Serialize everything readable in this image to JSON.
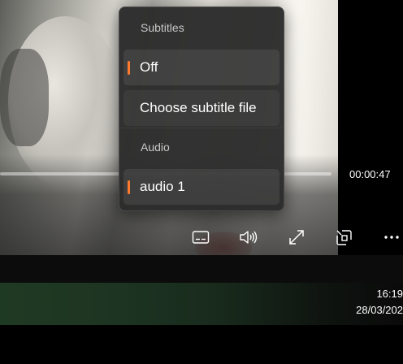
{
  "player": {
    "current_time": "00:00:47",
    "accent_color": "#ff7a2f"
  },
  "menu": {
    "subtitles_header": "Subtitles",
    "subtitle_off": "Off",
    "choose_subtitle_file": "Choose subtitle file",
    "audio_header": "Audio",
    "audio_track": "audio 1"
  },
  "controls": {
    "icons": [
      "subtitles-icon",
      "volume-icon",
      "fullscreen-icon",
      "mini-view-icon",
      "more-icon"
    ]
  },
  "taskbar": {
    "time": "16:19",
    "date": "28/03/202"
  }
}
